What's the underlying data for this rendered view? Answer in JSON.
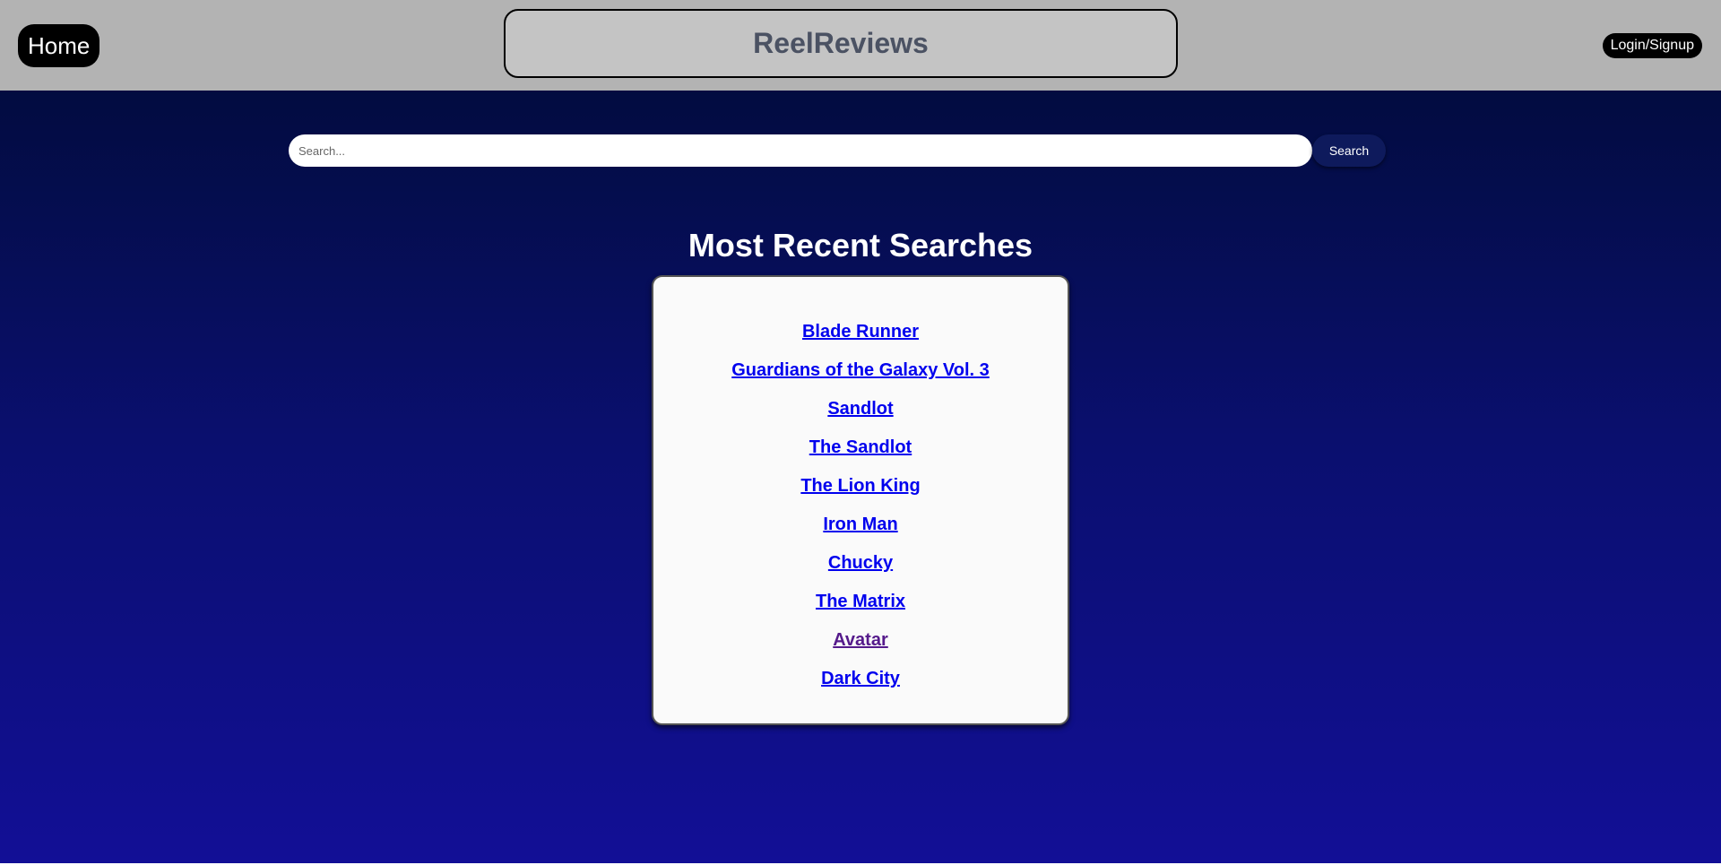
{
  "header": {
    "home_label": "Home",
    "brand_title": "ReelReviews",
    "login_label": "Login/Signup"
  },
  "search": {
    "placeholder": "Search...",
    "value": "",
    "button_label": "Search"
  },
  "recent": {
    "title": "Most Recent Searches",
    "items": [
      {
        "label": "Blade Runner",
        "visited": false
      },
      {
        "label": "Guardians of the Galaxy Vol. 3",
        "visited": false
      },
      {
        "label": "Sandlot",
        "visited": false
      },
      {
        "label": "The Sandlot",
        "visited": false
      },
      {
        "label": "The Lion King",
        "visited": false
      },
      {
        "label": "Iron Man",
        "visited": false
      },
      {
        "label": "Chucky",
        "visited": false
      },
      {
        "label": "The Matrix",
        "visited": false
      },
      {
        "label": "Avatar",
        "visited": true
      },
      {
        "label": "Dark City",
        "visited": false
      }
    ]
  },
  "colors": {
    "header_bg": "#b3b3b3",
    "link": "#0000ee",
    "visited_link": "#551a8b",
    "gradient_top": "#020c40",
    "gradient_bottom": "#120f96"
  }
}
